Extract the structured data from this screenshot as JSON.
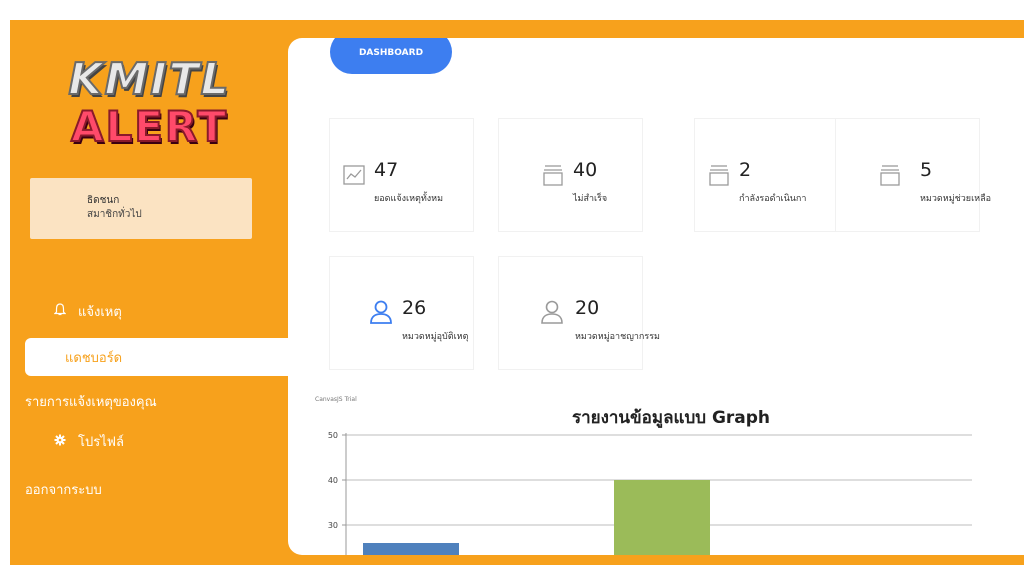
{
  "sidebar": {
    "logo_line1": "KMITL",
    "logo_line2": "ALERT",
    "user_name": "ธิดชนก",
    "user_role": "สมาชิกทั่วไป",
    "items": [
      {
        "label": "แจ้งเหตุ",
        "icon": "bell-icon"
      },
      {
        "label": "แดชบอร์ด",
        "icon": ""
      },
      {
        "label": "รายการแจ้งเหตุของคุณ",
        "icon": ""
      },
      {
        "label": "โปรไฟล์",
        "icon": "gear-icon"
      },
      {
        "label": "ออกจากระบบ",
        "icon": ""
      }
    ]
  },
  "main": {
    "dashboard_label": "DASHBOARD",
    "stats": [
      {
        "value": "47",
        "label": "ยอดแจ้งเหตุทั้งหม",
        "icon": "chart-icon"
      },
      {
        "value": "40",
        "label": "ไม่สำเร็จ",
        "icon": "inbox-icon"
      },
      {
        "value": "2",
        "label": "กำลังรอดำเนินกา",
        "icon": "inbox-icon"
      },
      {
        "value": "5",
        "label": "หมวดหมู่ช่วยเหลือ",
        "icon": "inbox-icon"
      },
      {
        "value": "26",
        "label": "หมวดหมู่อุบัติเหตุ",
        "icon": "user-icon"
      },
      {
        "value": "20",
        "label": "หมวดหมู่อาชญากรรม",
        "icon": "user-icon"
      }
    ]
  },
  "colors": {
    "accent_orange": "#f7a11c",
    "dashboard_blue": "#3d7ef0",
    "bar_blue": "#4f81bd",
    "bar_green": "#9bbb59",
    "stat_icon_blue": "#3d7ef0",
    "stat_icon_gray": "#9a9a9a"
  },
  "chart_data": {
    "type": "bar",
    "title": "รายงานข้อมูลแบบ Graph",
    "watermark": "CanvasJS Trial",
    "y_ticks": [
      50,
      40,
      30
    ],
    "ylim": [
      25,
      50
    ],
    "bars": [
      {
        "value": 26,
        "color": "#4f81bd"
      },
      {
        "value": 40,
        "color": "#9bbb59"
      }
    ]
  }
}
